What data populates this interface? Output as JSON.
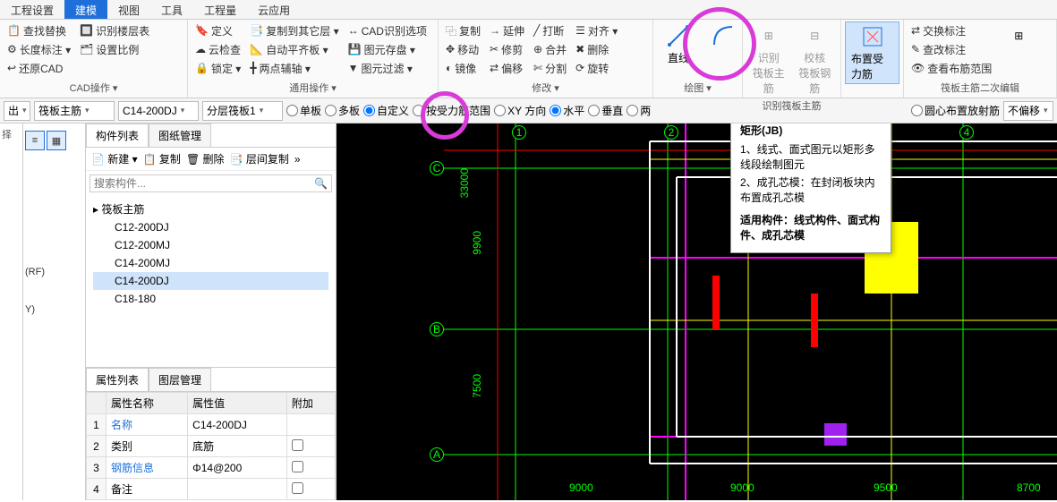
{
  "tabs": [
    "工程设置",
    "建模",
    "视图",
    "工具",
    "工程量",
    "云应用"
  ],
  "activeTab": 1,
  "ribbon": {
    "g_cad": {
      "label": "CAD操作 ▾",
      "items": [
        "查找替换",
        "识别楼层表",
        "定义",
        "复制到其它层 ▾",
        "长度标注 ▾",
        "设置比例",
        "CAD识别选项",
        "还原CAD",
        "自动平齐板 ▾",
        "云检查",
        "图元存盘 ▾",
        "锁定 ▾",
        "两点辅轴 ▾",
        "图元过滤 ▾"
      ]
    },
    "g_common": {
      "label": "通用操作 ▾"
    },
    "g_modify": {
      "label": "修改 ▾",
      "items": [
        "复制",
        "延伸",
        "打断",
        "对齐 ▾",
        "移动",
        "修剪",
        "合并",
        "删除",
        "镜像",
        "偏移",
        "分割",
        "旋转"
      ]
    },
    "g_draw": {
      "label": "绘图 ▾",
      "line": "直线"
    },
    "g_rec": {
      "label": "识别筏板主筋",
      "a": "识别\n筏板主筋",
      "b": "校核\n筏板钢筋"
    },
    "g_place": {
      "label": "布置受力筋"
    },
    "g_edit2": {
      "label": "筏板主筋二次编辑",
      "items": [
        "交换标注",
        "查改标注",
        "查看布筋范围"
      ]
    }
  },
  "bar2": {
    "dd0": "出",
    "dd1": "筏板主筋",
    "dd2": "C14-200DJ",
    "dd3": "分层筏板1",
    "radios": [
      "单板",
      "多板",
      "自定义",
      "按受力筋范围",
      "XY 方向",
      "水平",
      "垂直",
      "两",
      "圆心布置放射筋"
    ],
    "dd4": "不偏移"
  },
  "left": {
    "rf": "(RF)",
    "y": "Y)"
  },
  "midPanel": {
    "tabs": [
      "构件列表",
      "图纸管理"
    ],
    "toolbar": [
      "新建 ▾",
      "复制",
      "删除",
      "层间复制"
    ],
    "searchPlaceholder": "搜索构件...",
    "treeRoot": "▸ 筏板主筋",
    "treeItems": [
      "C12-200DJ",
      "C12-200MJ",
      "C14-200MJ",
      "C14-200DJ",
      "C18-180"
    ],
    "treeSel": 3,
    "propTabs": [
      "属性列表",
      "图层管理"
    ],
    "propHeaders": [
      "",
      "属性名称",
      "属性值",
      "附加"
    ],
    "propRows": [
      {
        "n": "1",
        "name": "名称",
        "val": "C14-200DJ",
        "chk": false,
        "link": true
      },
      {
        "n": "2",
        "name": "类别",
        "val": "底筋",
        "chk": true,
        "link": false
      },
      {
        "n": "3",
        "name": "钢筋信息",
        "val": "Φ14@200",
        "chk": true,
        "link": true
      },
      {
        "n": "4",
        "name": "备注",
        "val": "",
        "chk": true,
        "link": false
      }
    ]
  },
  "tooltip": {
    "title": "矩形(JB)",
    "l1": "1、线式、面式图元以矩形多线段绘制图元",
    "l2": "2、成孔芯模：在封闭板块内布置成孔芯模",
    "l3": "适用构件：线式构件、面式构件、成孔芯模"
  },
  "canvas": {
    "cols": [
      "1",
      "2",
      "4"
    ],
    "rows": [
      "C",
      "B",
      "A"
    ],
    "dims_v": [
      "33000",
      "9900",
      "7500"
    ],
    "dims_h": [
      "9000",
      "9000",
      "9500",
      "8700"
    ]
  }
}
